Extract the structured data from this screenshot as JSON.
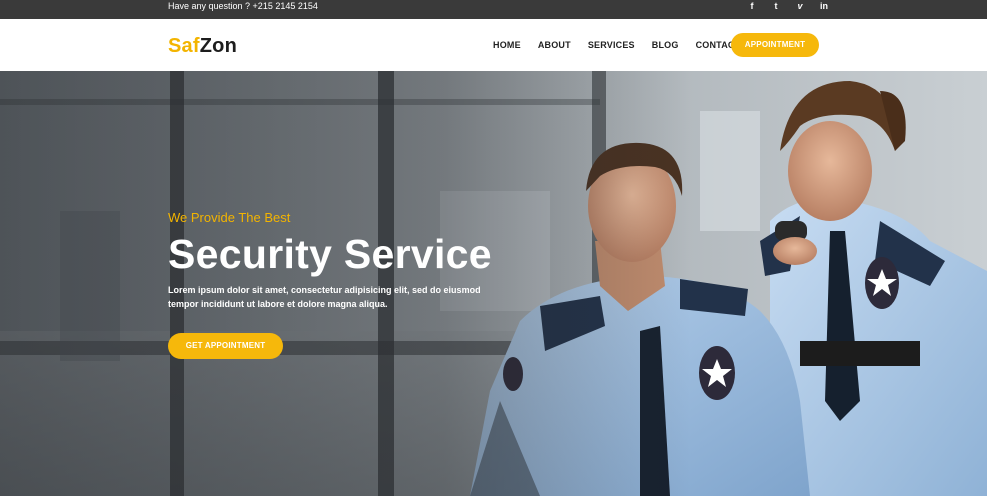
{
  "topbar": {
    "question": "Have any question ? +215 2145 2154",
    "social": [
      {
        "icon": "facebook-icon",
        "glyph": "f"
      },
      {
        "icon": "twitter-icon",
        "glyph": "t"
      },
      {
        "icon": "vimeo-icon",
        "glyph": "v"
      },
      {
        "icon": "linkedin-icon",
        "glyph": "in"
      }
    ]
  },
  "header": {
    "logo_part1": "Saf",
    "logo_part2": "Zon",
    "nav": [
      "HOME",
      "ABOUT",
      "SERVICES",
      "BLOG",
      "CONTACT"
    ],
    "cta": "APPOINTMENT"
  },
  "hero": {
    "tagline": "We Provide The Best",
    "title": "Security Service",
    "description": "Lorem ipsum dolor sit amet, consectetur adipisicing elit, sed do eiusmod tempor incididunt ut labore et dolore magna aliqua.",
    "cta": "GET APPOINTMENT"
  },
  "colors": {
    "accent": "#f6b80b",
    "topbar": "#3a3a3a",
    "text_dark": "#222222"
  }
}
